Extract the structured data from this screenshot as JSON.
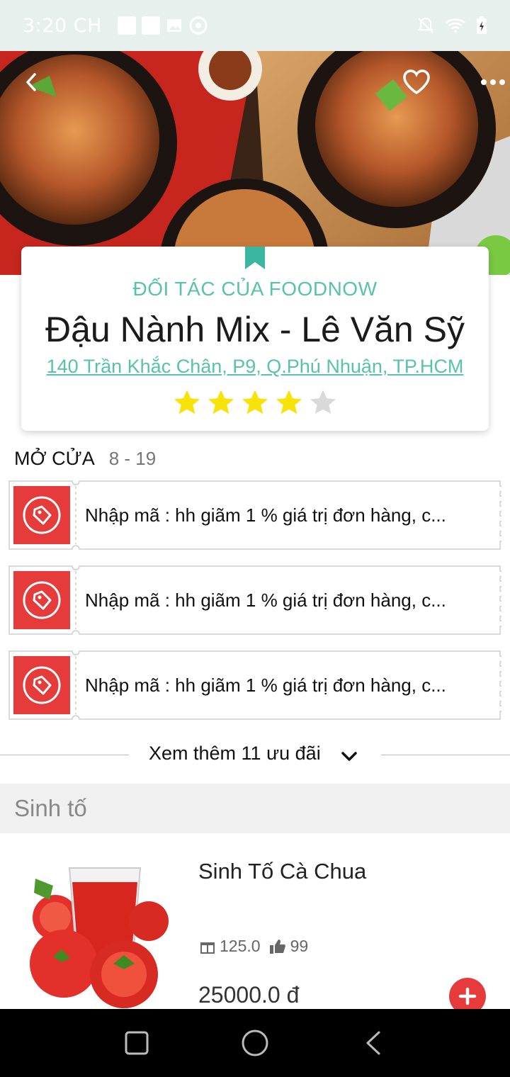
{
  "status_bar": {
    "time": "3:20 CH"
  },
  "shop": {
    "partner_label": "ĐỐI TÁC CỦA FOODNOW",
    "name": "Đậu Nành Mix - Lê Văn Sỹ",
    "address": "140 Trần Khắc Chân, P9, Q.Phú Nhuận, TP.HCM",
    "rating": 4,
    "rating_max": 5
  },
  "hours": {
    "label": "MỞ CỬA",
    "value": "8 - 19"
  },
  "coupons": [
    {
      "text": "Nhập mã : hh giãm 1 % giá trị đơn hàng, c..."
    },
    {
      "text": "Nhập mã : hh giãm 1 % giá trị đơn hàng, c..."
    },
    {
      "text": "Nhập mã : hh giãm 1 % giá trị đơn hàng, c..."
    }
  ],
  "more_offers": {
    "label": "Xem thêm 11 ưu đãi"
  },
  "section": {
    "title": "Sinh tố"
  },
  "product": {
    "name": "Sinh Tố Cà Chua",
    "stat_sold": "125.0",
    "stat_likes": "99",
    "price": "25000.0 đ"
  },
  "colors": {
    "accent": "#58c3aa",
    "coupon_red": "#e53b3b",
    "star_on": "#f7e20a",
    "star_off": "#d9d9d9"
  }
}
